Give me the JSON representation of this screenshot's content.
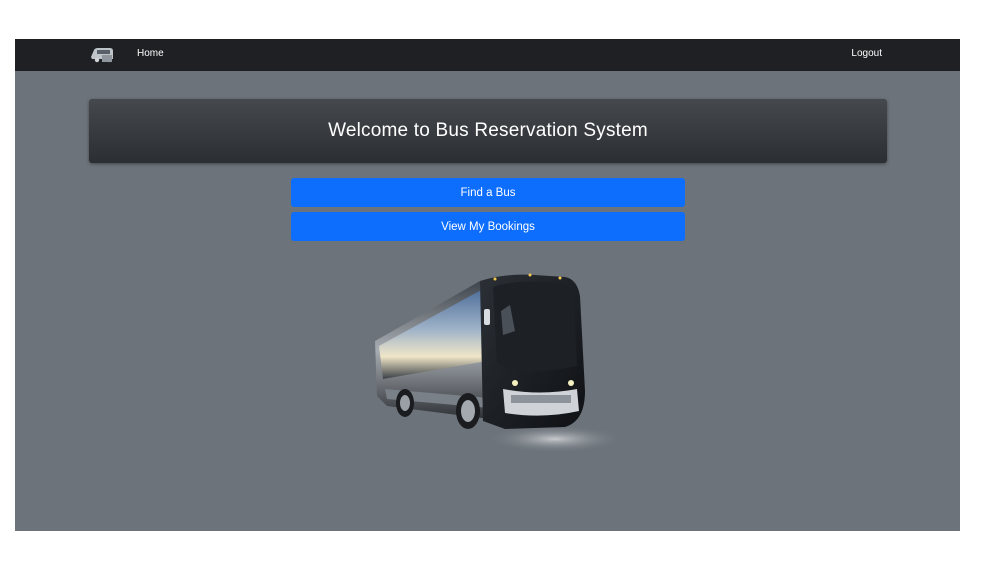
{
  "navbar": {
    "home_label": "Home",
    "logout_label": "Logout",
    "logo_icon": "bus-logo-icon"
  },
  "banner": {
    "title": "Welcome to Bus Reservation System"
  },
  "actions": {
    "find_bus_label": "Find a Bus",
    "view_bookings_label": "View My Bookings"
  },
  "hero": {
    "image": "coach-bus-image"
  },
  "colors": {
    "navbar_bg": "#1e2024",
    "page_bg": "#6c737a",
    "banner_bg": "#343a40",
    "button_bg": "#0d6efd",
    "text": "#ffffff"
  }
}
